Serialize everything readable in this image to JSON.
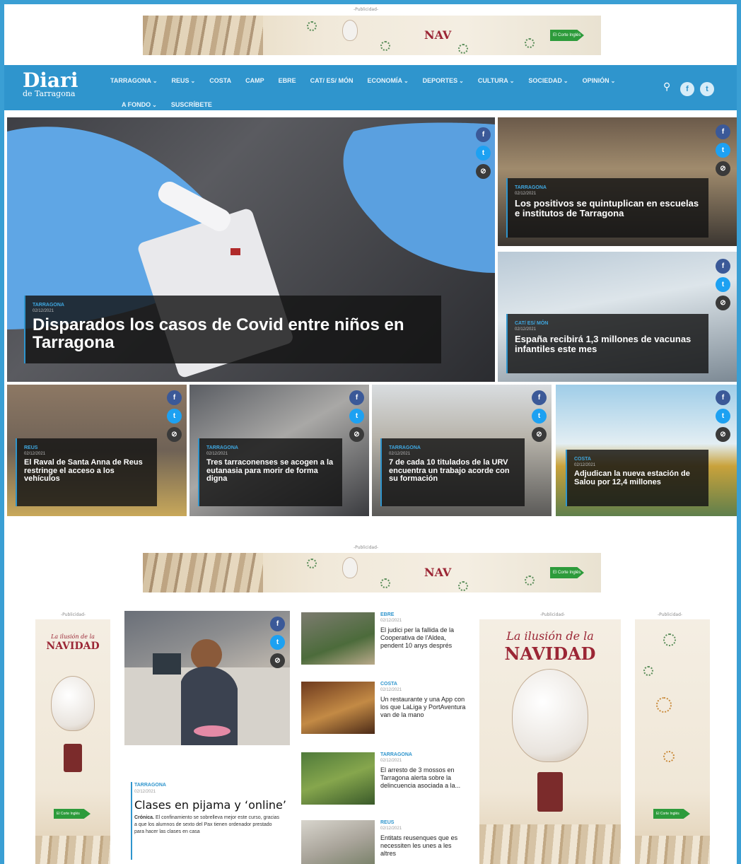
{
  "ads": {
    "label": "-Publicidad-",
    "brand": "NAV",
    "store": "El Corte Inglés",
    "sky_title_line1": "La ilusión de la",
    "sky_title_line2": "NAVIDAD"
  },
  "nav": {
    "logo_main": "Diari",
    "logo_sub": "de Tarragona",
    "row1": [
      {
        "label": "TARRAGONA",
        "chevron": true
      },
      {
        "label": "REUS",
        "chevron": true
      },
      {
        "label": "COSTA",
        "chevron": false
      },
      {
        "label": "CAMP",
        "chevron": false
      },
      {
        "label": "EBRE",
        "chevron": false
      },
      {
        "label": "CAT/ ES/ MÓN",
        "chevron": false
      },
      {
        "label": "ECONOMÍA",
        "chevron": true
      },
      {
        "label": "DEPORTES",
        "chevron": true
      },
      {
        "label": "CULTURA",
        "chevron": true
      },
      {
        "label": "SOCIEDAD",
        "chevron": true
      },
      {
        "label": "OPINIÓN",
        "chevron": true
      }
    ],
    "row2": [
      {
        "label": "A FONDO",
        "chevron": true
      },
      {
        "label": "SUSCRÍBETE",
        "chevron": false
      }
    ],
    "chevron_glyph": "⌄",
    "search_glyph": "⚲",
    "facebook_glyph": "f",
    "twitter_glyph": "t"
  },
  "share": {
    "facebook": "f",
    "twitter": "t",
    "link": "⊘"
  },
  "hero": {
    "category": "TARRAGONA",
    "date": "02/12/2021",
    "title": "Disparados los casos de Covid entre niños en Tarragona"
  },
  "side_stories": [
    {
      "category": "TARRAGONA",
      "date": "02/12/2021",
      "title": "Los positivos se quintuplican en escuelas e institutos de Tarragona"
    },
    {
      "category": "CAT/ ES/ MÓN",
      "date": "02/12/2021",
      "title": "España recibirá 1,3 millones de vacunas infantiles este mes"
    }
  ],
  "row_stories": [
    {
      "category": "REUS",
      "date": "02/12/2021",
      "title": "El Raval de Santa Anna de Reus restringe el acceso a los vehículos"
    },
    {
      "category": "TARRAGONA",
      "date": "02/12/2021",
      "title": "Tres tarraconenses se acogen a la eutanasia para morir de forma digna"
    },
    {
      "category": "TARRAGONA",
      "date": "02/12/2021",
      "title": "7 de cada 10 titulados de la URV encuentra un trabajo acorde con su formación"
    },
    {
      "category": "COSTA",
      "date": "02/12/2021",
      "title": "Adjudican la nueva estación de Salou por 12,4 millones"
    }
  ],
  "feature": {
    "category": "TARRAGONA",
    "date": "02/12/2021",
    "title": "Clases en pijama y ‘online’",
    "lead": "Crónica.",
    "text": " El confinamiento se sobrelleva mejor este curso, gracias a que los alumnos de sexto del Pax tienen ordenador prestado para hacer las clases en casa"
  },
  "list": [
    {
      "category": "EBRE",
      "date": "02/12/2021",
      "title": "El judici per la fallida de la Cooperativa de l'Aldea, pendent 10 anys després"
    },
    {
      "category": "COSTA",
      "date": "02/12/2021",
      "title": "Un restaurante y una App con los que LaLiga y PortAventura van de la mano"
    },
    {
      "category": "TARRAGONA",
      "date": "02/12/2021",
      "title": "El arresto de 3 mossos en Tarragona alerta sobre la delincuencia asociada a la..."
    },
    {
      "category": "REUS",
      "date": "02/12/2021",
      "title": "Entitats reusenques que es necessiten les unes a les altres"
    }
  ],
  "colors": {
    "accent": "#2f95cd",
    "facebook": "#3b5998",
    "twitter": "#1da1f2",
    "ad_red": "#9b2635"
  }
}
